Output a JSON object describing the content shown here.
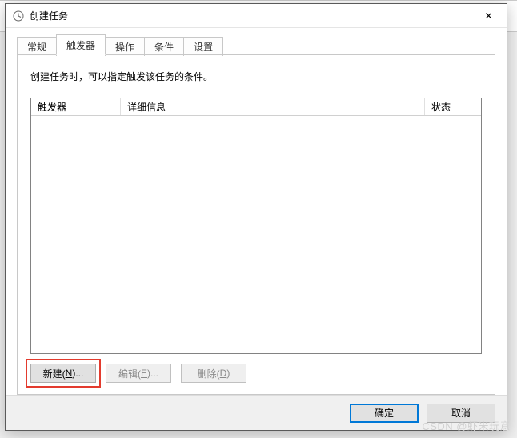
{
  "window": {
    "title": "创建任务",
    "close_icon": "✕"
  },
  "tabs": [
    {
      "label": "常规"
    },
    {
      "label": "触发器"
    },
    {
      "label": "操作"
    },
    {
      "label": "条件"
    },
    {
      "label": "设置"
    }
  ],
  "active_tab_index": 1,
  "triggers_page": {
    "description": "创建任务时，可以指定触发该任务的条件。",
    "columns": {
      "trigger": "触发器",
      "detail": "详细信息",
      "state": "状态"
    },
    "rows": [],
    "buttons": {
      "new_prefix": "新建(",
      "new_key": "N",
      "new_suffix": ")...",
      "edit_prefix": "编辑(",
      "edit_key": "E",
      "edit_suffix": ")...",
      "delete_prefix": "删除(",
      "delete_key": "D",
      "delete_suffix": ")"
    }
  },
  "footer": {
    "ok": "确定",
    "cancel": "取消"
  },
  "watermark": "CSDN @虾米玩意"
}
